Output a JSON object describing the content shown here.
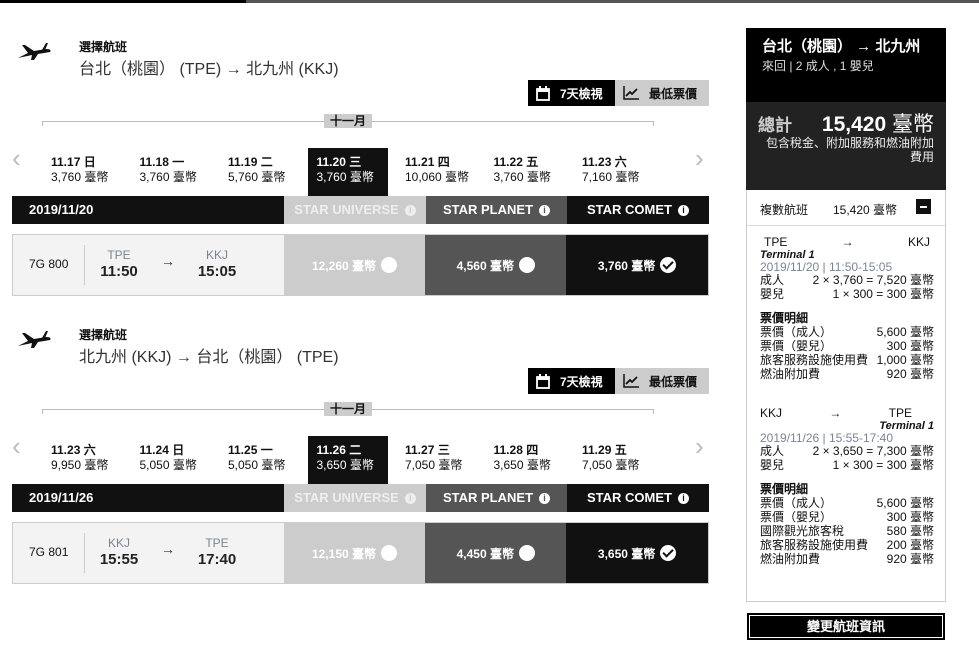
{
  "sections": [
    {
      "label": "選擇航班",
      "route": "台北（桃園） (TPE) → 北九州 (KKJ)",
      "view_week": "7天檢視",
      "view_lowest": "最低票價",
      "month": "十一月",
      "dates": [
        {
          "day": "11.17 日",
          "price": "3,760 臺幣"
        },
        {
          "day": "11.18 一",
          "price": "3,760 臺幣"
        },
        {
          "day": "11.19 二",
          "price": "5,760 臺幣"
        },
        {
          "day": "11.20 三",
          "price": "3,760 臺幣",
          "selected": true
        },
        {
          "day": "11.21 四",
          "price": "10,060 臺幣"
        },
        {
          "day": "11.22 五",
          "price": "3,760 臺幣"
        },
        {
          "day": "11.23 六",
          "price": "7,160 臺幣"
        }
      ],
      "selected_date": "2019/11/20",
      "fare_classes": [
        "STAR UNIVERSE",
        "STAR PLANET",
        "STAR COMET"
      ],
      "flight": {
        "number": "7G 800",
        "from_code": "TPE",
        "from_time": "11:50",
        "to_code": "KKJ",
        "to_time": "15:05",
        "arrow": "→",
        "fares": [
          "12,260 臺幣",
          "4,560 臺幣",
          "3,760 臺幣"
        ],
        "selected_fare": 2
      }
    },
    {
      "label": "選擇航班",
      "route": "北九州 (KKJ) → 台北（桃園） (TPE)",
      "view_week": "7天檢視",
      "view_lowest": "最低票價",
      "month": "十一月",
      "dates": [
        {
          "day": "11.23 六",
          "price": "9,950 臺幣"
        },
        {
          "day": "11.24 日",
          "price": "5,050 臺幣"
        },
        {
          "day": "11.25 一",
          "price": "5,050 臺幣"
        },
        {
          "day": "11.26 二",
          "price": "3,650 臺幣",
          "selected": true
        },
        {
          "day": "11.27 三",
          "price": "7,050 臺幣"
        },
        {
          "day": "11.28 四",
          "price": "3,650 臺幣"
        },
        {
          "day": "11.29 五",
          "price": "7,050 臺幣"
        }
      ],
      "selected_date": "2019/11/26",
      "fare_classes": [
        "STAR UNIVERSE",
        "STAR PLANET",
        "STAR COMET"
      ],
      "flight": {
        "number": "7G 801",
        "from_code": "KKJ",
        "from_time": "15:55",
        "to_code": "TPE",
        "to_time": "17:40",
        "arrow": "→",
        "fares": [
          "12,150 臺幣",
          "4,450 臺幣",
          "3,650 臺幣"
        ],
        "selected_fare": 2
      }
    }
  ],
  "nav": {
    "prev": "‹",
    "next": "›"
  },
  "sidebar": {
    "title": "台北（桃園） → 北九州",
    "subtitle": "來回 | 2 成人 , 1 嬰兒",
    "total_label": "總計",
    "total_amount": "15,420",
    "total_currency": "臺幣",
    "total_note": "包含稅金、附加服務和燃油附加費用",
    "detail_label": "複數航班",
    "detail_amount": "15,420 臺幣",
    "legs": [
      {
        "from": "TPE",
        "arrow": "→",
        "to": "KKJ",
        "terminal": "Terminal 1",
        "time": "2019/11/20 | 11:50-15:05",
        "pax": [
          {
            "label": "成人",
            "value": "2 × 3,760 = 7,520 臺幣"
          },
          {
            "label": "嬰兒",
            "value": "1 × 300 = 300 臺幣"
          }
        ],
        "breakdown_title": "票價明細",
        "breakdown": [
          {
            "label": "票價（成人）",
            "value": "5,600 臺幣"
          },
          {
            "label": "票價（嬰兒）",
            "value": "300 臺幣"
          },
          {
            "label": "旅客服務設施使用費",
            "value": "1,000 臺幣"
          },
          {
            "label": "燃油附加費",
            "value": "920 臺幣"
          }
        ]
      },
      {
        "from": "KKJ",
        "arrow": "→",
        "to": "TPE",
        "terminal": "Terminal 1",
        "time": "2019/11/26 | 15:55-17:40",
        "pax": [
          {
            "label": "成人",
            "value": "2 × 3,650 = 7,300 臺幣"
          },
          {
            "label": "嬰兒",
            "value": "1 × 300 = 300 臺幣"
          }
        ],
        "breakdown_title": "票價明細",
        "breakdown": [
          {
            "label": "票價（成人）",
            "value": "5,600 臺幣"
          },
          {
            "label": "票價（嬰兒）",
            "value": "300 臺幣"
          },
          {
            "label": "國際觀光旅客稅",
            "value": "580 臺幣"
          },
          {
            "label": "旅客服務設施使用費",
            "value": "200 臺幣"
          },
          {
            "label": "燃油附加費",
            "value": "920 臺幣"
          }
        ]
      }
    ],
    "change_button": "變更航班資訊"
  }
}
